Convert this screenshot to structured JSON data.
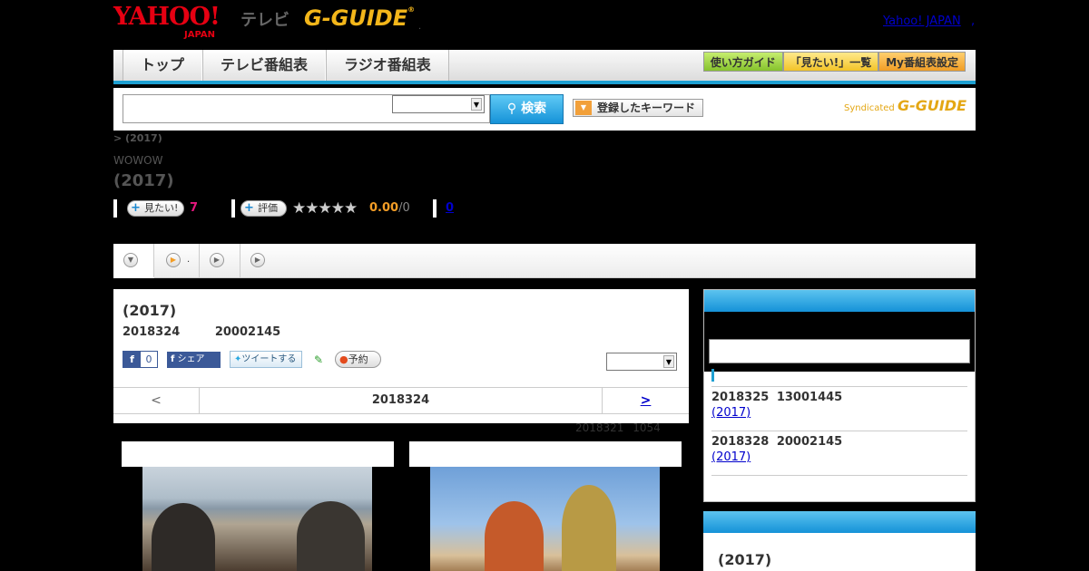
{
  "header": {
    "logo_yahoo": "YAHOO!",
    "logo_japan": "JAPAN",
    "logo_tv": "テレビ",
    "logo_gguide": "G-GUIDE",
    "logo_reg": "®",
    "dot": ".",
    "yahoo_link": "Yahoo! JAPAN",
    "link_sep": ","
  },
  "nav": {
    "tabs": [
      "トップ",
      "テレビ番組表",
      "ラジオ番組表"
    ],
    "buttons": [
      "使い方ガイド",
      "「見たい!」一覧",
      "My番組表設定"
    ]
  },
  "search": {
    "input_value": "",
    "select_value": "",
    "button_label": "検索",
    "keyword_button": "登録したキーワード",
    "syndicated": "Syndicated",
    "syndicated_logo": "G-GUIDE"
  },
  "program": {
    "breadcrumb": "> (2017)",
    "channel": "WOWOW",
    "title": "(2017)",
    "want_label": "見たい!",
    "want_count": "7",
    "rate_label": "評価",
    "stars": "★★★★★",
    "rating": "0.00",
    "rating_den": "/0",
    "review_count": "0"
  },
  "subtabs": {
    "tab2_text": "."
  },
  "card": {
    "title": "(2017)",
    "datetime": "2018324 20002145",
    "fb_count": "0",
    "fb_share": "シェア",
    "tweet": "ツイートする",
    "reserve": "予約",
    "select_value": "",
    "prev": "<",
    "current_date": "2018324",
    "next": ">",
    "updated": "2018321 1054"
  },
  "sidebar": {
    "airings": [
      {
        "datetime": "2018325 13001445",
        "link": "(2017)"
      },
      {
        "datetime": "2018328 20002145",
        "link": "(2017)"
      }
    ],
    "second_title": "(2017)"
  }
}
